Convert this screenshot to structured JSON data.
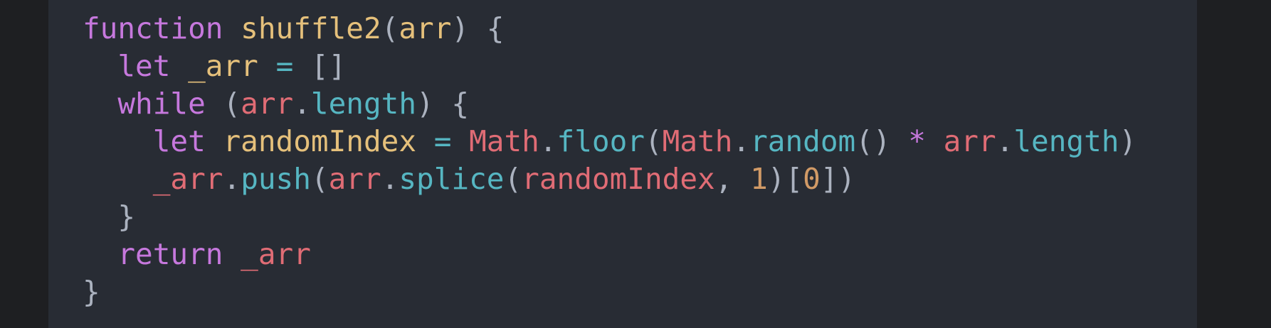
{
  "colors": {
    "background": "#1e1f22",
    "panel": "#282c34",
    "keyword": "#c678dd",
    "function": "#e5c07b",
    "variable": "#e06c75",
    "property": "#56b6c2",
    "number": "#d19a66",
    "default": "#abb2bf"
  },
  "code": {
    "language": "javascript",
    "lines": [
      {
        "indent": "",
        "tokens": [
          {
            "text": "function",
            "kind": "keyword"
          },
          {
            "text": " ",
            "kind": "default"
          },
          {
            "text": "shuffle2",
            "kind": "function"
          },
          {
            "text": "(",
            "kind": "default"
          },
          {
            "text": "arr",
            "kind": "function"
          },
          {
            "text": ") {",
            "kind": "default"
          }
        ]
      },
      {
        "indent": "  ",
        "tokens": [
          {
            "text": "let",
            "kind": "keyword"
          },
          {
            "text": " ",
            "kind": "default"
          },
          {
            "text": "_arr",
            "kind": "function"
          },
          {
            "text": " ",
            "kind": "default"
          },
          {
            "text": "=",
            "kind": "property"
          },
          {
            "text": " []",
            "kind": "default"
          }
        ]
      },
      {
        "indent": "  ",
        "tokens": [
          {
            "text": "while",
            "kind": "keyword"
          },
          {
            "text": " (",
            "kind": "default"
          },
          {
            "text": "arr",
            "kind": "variable"
          },
          {
            "text": ".",
            "kind": "default"
          },
          {
            "text": "length",
            "kind": "property"
          },
          {
            "text": ") {",
            "kind": "default"
          }
        ]
      },
      {
        "indent": "    ",
        "tokens": [
          {
            "text": "let",
            "kind": "keyword"
          },
          {
            "text": " ",
            "kind": "default"
          },
          {
            "text": "randomIndex",
            "kind": "function"
          },
          {
            "text": " ",
            "kind": "default"
          },
          {
            "text": "=",
            "kind": "property"
          },
          {
            "text": " ",
            "kind": "default"
          },
          {
            "text": "Math",
            "kind": "variable"
          },
          {
            "text": ".",
            "kind": "default"
          },
          {
            "text": "floor",
            "kind": "property"
          },
          {
            "text": "(",
            "kind": "default"
          },
          {
            "text": "Math",
            "kind": "variable"
          },
          {
            "text": ".",
            "kind": "default"
          },
          {
            "text": "random",
            "kind": "property"
          },
          {
            "text": "() ",
            "kind": "default"
          },
          {
            "text": "*",
            "kind": "keyword"
          },
          {
            "text": " ",
            "kind": "default"
          },
          {
            "text": "arr",
            "kind": "variable"
          },
          {
            "text": ".",
            "kind": "default"
          },
          {
            "text": "length",
            "kind": "property"
          },
          {
            "text": ")",
            "kind": "default"
          }
        ]
      },
      {
        "indent": "    ",
        "tokens": [
          {
            "text": "_arr",
            "kind": "variable"
          },
          {
            "text": ".",
            "kind": "default"
          },
          {
            "text": "push",
            "kind": "property"
          },
          {
            "text": "(",
            "kind": "default"
          },
          {
            "text": "arr",
            "kind": "variable"
          },
          {
            "text": ".",
            "kind": "default"
          },
          {
            "text": "splice",
            "kind": "property"
          },
          {
            "text": "(",
            "kind": "default"
          },
          {
            "text": "randomIndex",
            "kind": "variable"
          },
          {
            "text": ", ",
            "kind": "default"
          },
          {
            "text": "1",
            "kind": "number"
          },
          {
            "text": ")[",
            "kind": "default"
          },
          {
            "text": "0",
            "kind": "number"
          },
          {
            "text": "])",
            "kind": "default"
          }
        ]
      },
      {
        "indent": "  ",
        "tokens": [
          {
            "text": "}",
            "kind": "default"
          }
        ]
      },
      {
        "indent": "  ",
        "tokens": [
          {
            "text": "return",
            "kind": "keyword"
          },
          {
            "text": " ",
            "kind": "default"
          },
          {
            "text": "_arr",
            "kind": "variable"
          }
        ]
      },
      {
        "indent": "",
        "tokens": [
          {
            "text": "}",
            "kind": "default"
          }
        ]
      }
    ]
  }
}
